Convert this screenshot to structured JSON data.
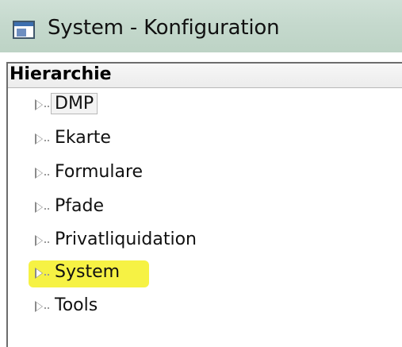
{
  "window": {
    "title": "System - Konfiguration",
    "icon": "window-app-icon"
  },
  "tree": {
    "header": "Hierarchie",
    "items": [
      {
        "label": "DMP",
        "selected": true
      },
      {
        "label": "Ekarte",
        "selected": false
      },
      {
        "label": "Formulare",
        "selected": false
      },
      {
        "label": "Pfade",
        "selected": false
      },
      {
        "label": "Privatliquidation",
        "selected": false
      },
      {
        "label": "System",
        "selected": false,
        "highlighted": true
      },
      {
        "label": "Tools",
        "selected": false
      }
    ]
  },
  "colors": {
    "titlebar": "#c5d9cd",
    "highlight_marker": "#f6f13a",
    "header_bg": "#ececec"
  }
}
